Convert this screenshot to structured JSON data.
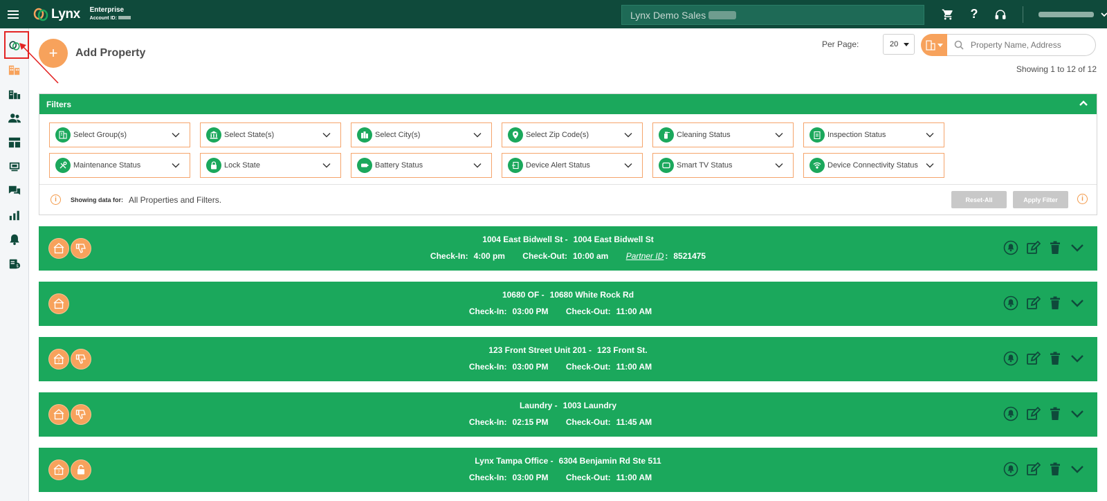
{
  "header": {
    "logo_text": "Lynx",
    "plan_name": "Enterprise",
    "account_label": "Account ID:",
    "company_name": "Lynx Demo Sales"
  },
  "main": {
    "add_property_label": "Add Property",
    "per_page_label": "Per Page:",
    "per_page_value": "20",
    "search_placeholder": "Property Name, Address",
    "showing_count": "Showing 1 to 12 of 12"
  },
  "filters": {
    "title": "Filters",
    "items": [
      {
        "label": "Select Group(s)",
        "icon": "building-icon"
      },
      {
        "label": "Select State(s)",
        "icon": "bank-icon"
      },
      {
        "label": "Select City(s)",
        "icon": "city-icon"
      },
      {
        "label": "Select Zip Code(s)",
        "icon": "location-pin-icon"
      },
      {
        "label": "Cleaning Status",
        "icon": "spray-bottle-icon"
      },
      {
        "label": "Inspection Status",
        "icon": "clipboard-icon"
      },
      {
        "label": "Maintenance Status",
        "icon": "tools-icon"
      },
      {
        "label": "Lock State",
        "icon": "lock-icon"
      },
      {
        "label": "Battery Status",
        "icon": "battery-icon"
      },
      {
        "label": "Device Alert Status",
        "icon": "device-alert-icon"
      },
      {
        "label": "Smart TV Status",
        "icon": "tv-icon"
      },
      {
        "label": "Device Connectivity Status",
        "icon": "wifi-icon"
      }
    ],
    "showing_label": "Showing data for:",
    "showing_value": "All Properties and Filters.",
    "reset_label": "Reset-All",
    "apply_label": "Apply Filter"
  },
  "labels": {
    "check_in": "Check-In:",
    "check_out": "Check-Out:",
    "partner_id": "Partner ID"
  },
  "properties": [
    {
      "code": "1004 East Bidwell St -",
      "address": "1004 East Bidwell St",
      "check_in": "4:00 pm",
      "check_out": "10:00 am",
      "partner_id": "8521475"
    },
    {
      "code": "10680 OF -",
      "address": "10680 White Rock Rd",
      "check_in": "03:00 PM",
      "check_out": "11:00 AM"
    },
    {
      "code": "123 Front Street Unit 201 -",
      "address": "123 Front St.",
      "check_in": "03:00 PM",
      "check_out": "11:00 AM"
    },
    {
      "code": "Laundry -",
      "address": "1003 Laundry",
      "check_in": "02:15 PM",
      "check_out": "11:45 AM"
    },
    {
      "code": "Lynx Tampa Office -",
      "address": "6304 Benjamin Rd Ste 511",
      "check_in": "03:00 PM",
      "check_out": "11:00 AM"
    }
  ],
  "colors": {
    "topbar": "#0f4a3b",
    "accent_green": "#1ba85c",
    "accent_orange": "#f7a25c",
    "highlight_red": "#e32323"
  }
}
